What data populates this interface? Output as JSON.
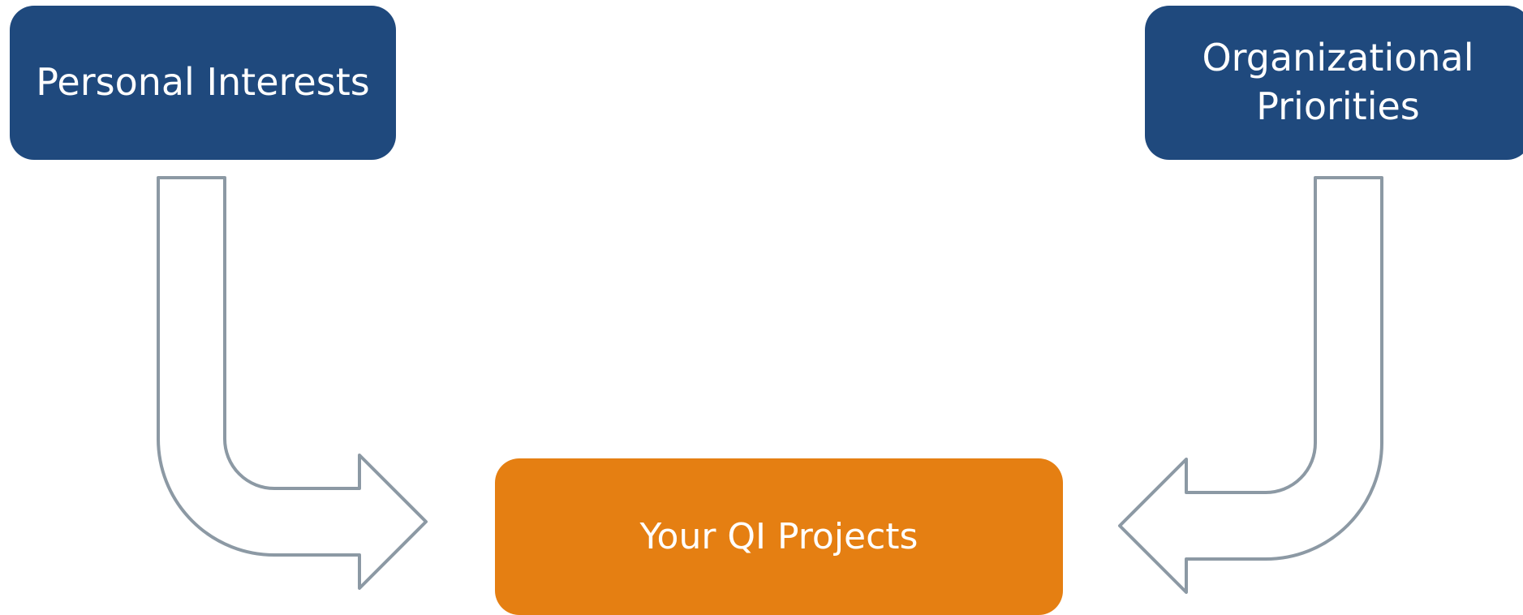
{
  "diagram": {
    "nodes": {
      "personal_interests": {
        "label": "Personal Interests",
        "color": "#1f497d"
      },
      "organizational_priorities": {
        "label": "Organizational Priorities",
        "color": "#1f497d"
      },
      "your_qi_projects": {
        "label": "Your QI Projects",
        "color": "#e57f12"
      }
    },
    "edges": [
      {
        "from": "personal_interests",
        "to": "your_qi_projects",
        "style": "bent-outline-arrow"
      },
      {
        "from": "organizational_priorities",
        "to": "your_qi_projects",
        "style": "bent-outline-arrow"
      }
    ],
    "arrow_stroke_color": "#8c99a4"
  }
}
